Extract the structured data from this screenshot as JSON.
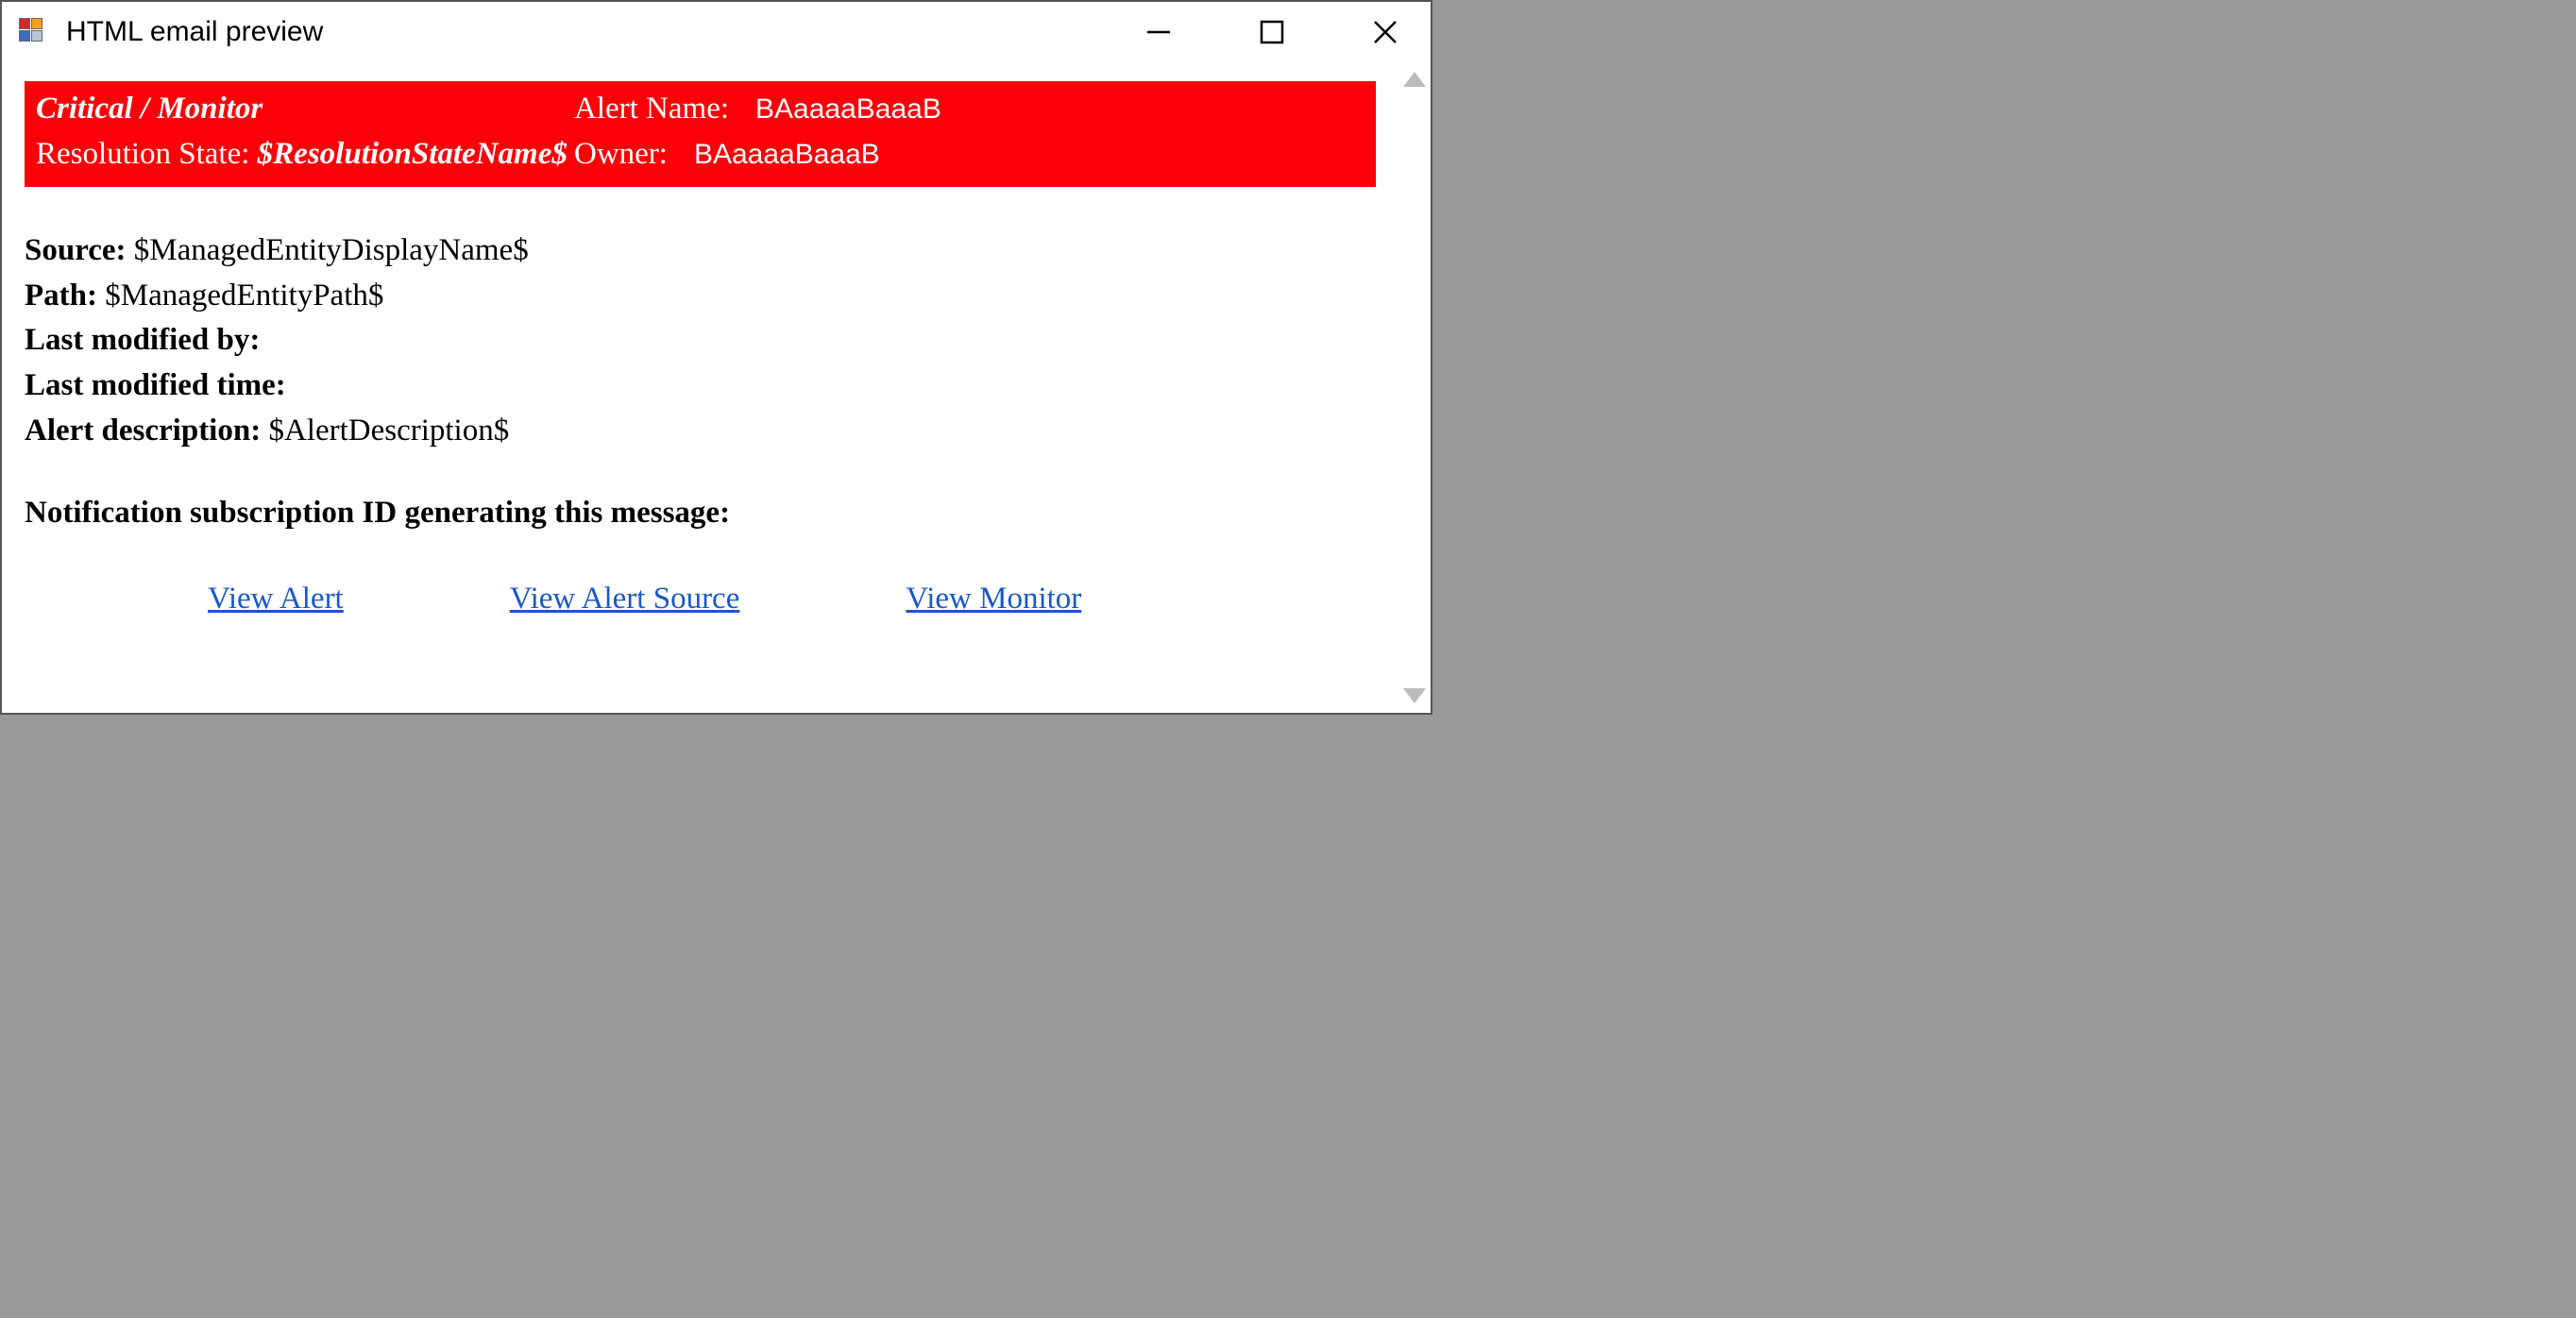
{
  "window": {
    "title": "HTML email preview"
  },
  "banner": {
    "severity": "Critical / Monitor",
    "alert_name_label": "Alert Name:",
    "alert_name_value": "BAaaaaBaaaB",
    "resolution_label": "Resolution State: ",
    "resolution_value": "$ResolutionStateName$",
    "owner_label": "Owner:",
    "owner_value": "BAaaaaBaaaB"
  },
  "body": {
    "source_label": "Source: ",
    "source_value": "$ManagedEntityDisplayName$",
    "path_label": "Path: ",
    "path_value": "$ManagedEntityPath$",
    "modby_label": "Last modified by:",
    "modby_value": "",
    "modtime_label": "Last modified time:",
    "modtime_value": "",
    "alertdesc_label": "Alert description: ",
    "alertdesc_value": "$AlertDescription$"
  },
  "subscription": {
    "label": "Notification subscription ID generating this message:"
  },
  "links": {
    "view_alert": "View Alert",
    "view_source": "View Alert Source",
    "view_monitor": "View Monitor"
  }
}
